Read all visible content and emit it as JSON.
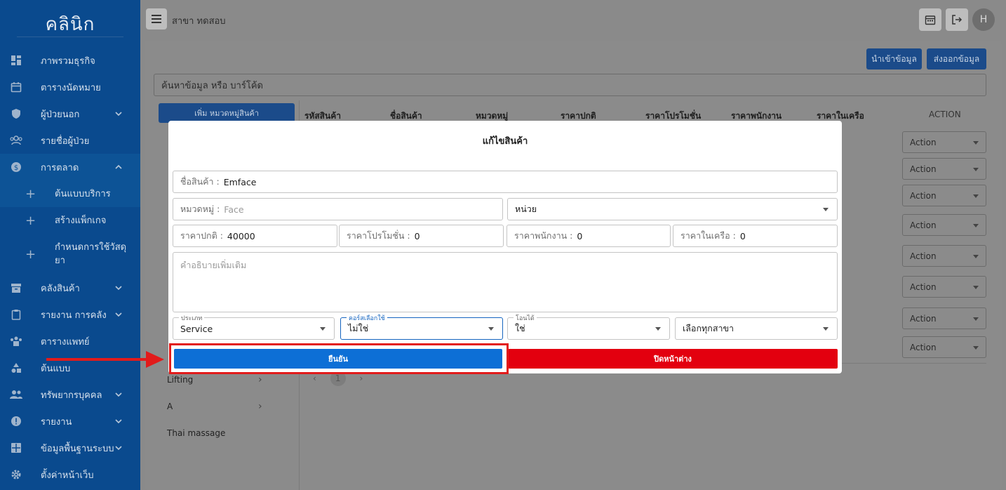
{
  "app": {
    "logo": "คลินิก",
    "branch": "สาขา ทดสอบ",
    "avatar": "H"
  },
  "sidebar": {
    "items": [
      {
        "label": "ภาพรวมธุรกิจ",
        "icon": "dashboard-icon"
      },
      {
        "label": "ตารางนัดหมาย",
        "icon": "calendar-icon"
      },
      {
        "label": "ผู้ป่วยนอก",
        "icon": "shield-icon"
      },
      {
        "label": "รายชื่อผู้ป่วย",
        "icon": "people-icon"
      },
      {
        "label": "การตลาด",
        "icon": "dollar-icon"
      },
      {
        "label": "ต้นแบบบริการ"
      },
      {
        "label": "สร้างแพ็กเกจ"
      },
      {
        "label": "กำหนดการใช้วัสดุ",
        "label2": "ยา"
      },
      {
        "label": "คลังสินค้า",
        "icon": "archive-icon"
      },
      {
        "label": "รายงาน การคลัง",
        "icon": "clipboard-icon"
      },
      {
        "label": "ตารางแพทย์",
        "icon": "doctor-icon"
      },
      {
        "label": "ต้นแบบ",
        "icon": "shapes-icon"
      },
      {
        "label": "ทรัพยากรบุคคล",
        "icon": "group-icon"
      },
      {
        "label": "รายงาน",
        "icon": "info-icon"
      },
      {
        "label": "ข้อมูลพื้นฐานระบบ",
        "icon": "grid-icon"
      },
      {
        "label": "ตั้งค่าหน้าเว็บ",
        "icon": "settings-icon"
      }
    ]
  },
  "toolbar": {
    "import_label": "นำเข้าข้อมูล",
    "export_label": "ส่งออกข้อมูล"
  },
  "search": {
    "placeholder": "ค้นหาข้อมูล หรือ บาร์โค้ด"
  },
  "categories": {
    "add_label": "เพิ่ม หมวดหมู่สินค้า",
    "items": [
      "Lifting",
      "A",
      "Thai massage"
    ]
  },
  "table": {
    "headers": [
      "รหัสสินค้า",
      "ชื่อสินค้า",
      "หมวดหมู่",
      "ราคาปกติ",
      "ราคาโปรโมชั่น",
      "ราคาพนักงาน",
      "ราคาในเครือ",
      "ACTION"
    ],
    "action_label": "Action",
    "page": "1"
  },
  "modal": {
    "title": "แก้ไขสินค้า",
    "name_label": "ชื่อสินค้า :",
    "name_value": "Emface",
    "category_label": "หมวดหมู่ :",
    "category_value": "Face",
    "unit_value": "หน่วย",
    "price_label": "ราคาปกติ :",
    "price_value": "40000",
    "promo_label": "ราคาโปรโมชั่น :",
    "promo_value": "0",
    "staff_label": "ราคาพนักงาน :",
    "staff_value": "0",
    "network_label": "ราคาในเครือ :",
    "network_value": "0",
    "description_placeholder": "คำอธิบายเพิ่มเติม",
    "type_label": "ประเภท",
    "type_value": "Service",
    "course_label": "คอร์สเลือกใช้",
    "course_value": "ไม่ใช่",
    "transfer_label": "โอนได้",
    "transfer_value": "ใช่",
    "branch_value": "เลือกทุกสาขา",
    "confirm_label": "ยืนยัน",
    "close_label": "ปิดหน้าต่าง"
  }
}
